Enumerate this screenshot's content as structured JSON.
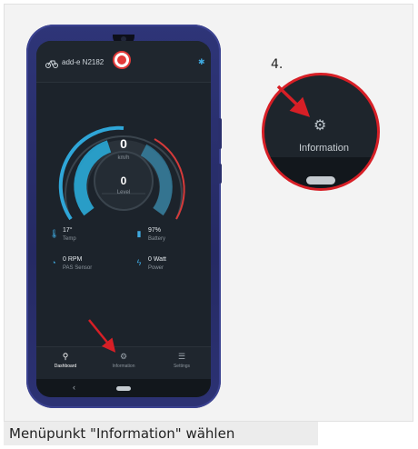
{
  "app": {
    "device_name": "add-e N2182",
    "speed_value": "0",
    "speed_unit": "km/h",
    "level_value": "0",
    "level_label": "Level"
  },
  "stats": [
    {
      "icon": "thermometer-icon",
      "value": "17°",
      "label": "Temp"
    },
    {
      "icon": "battery-icon",
      "value": "97%",
      "label": "Battery"
    },
    {
      "icon": "speedometer-icon",
      "value": "0 RPM",
      "label": "PAS Sensor"
    },
    {
      "icon": "lightning-icon",
      "value": "0 Watt",
      "label": "Power"
    }
  ],
  "nav": [
    {
      "icon": "bike-icon",
      "label": "Dashboard",
      "active": true
    },
    {
      "icon": "gear-icon",
      "label": "Information",
      "active": false
    },
    {
      "icon": "sliders-icon",
      "label": "Settings",
      "active": false
    }
  ],
  "callout": {
    "step": "4.",
    "zoom_label": "Information"
  },
  "caption": "Menüpunkt \"Information\" wählen",
  "colors": {
    "accent": "#3fa9e0",
    "highlight": "#d71f26",
    "screen_bg": "#1c232b"
  }
}
